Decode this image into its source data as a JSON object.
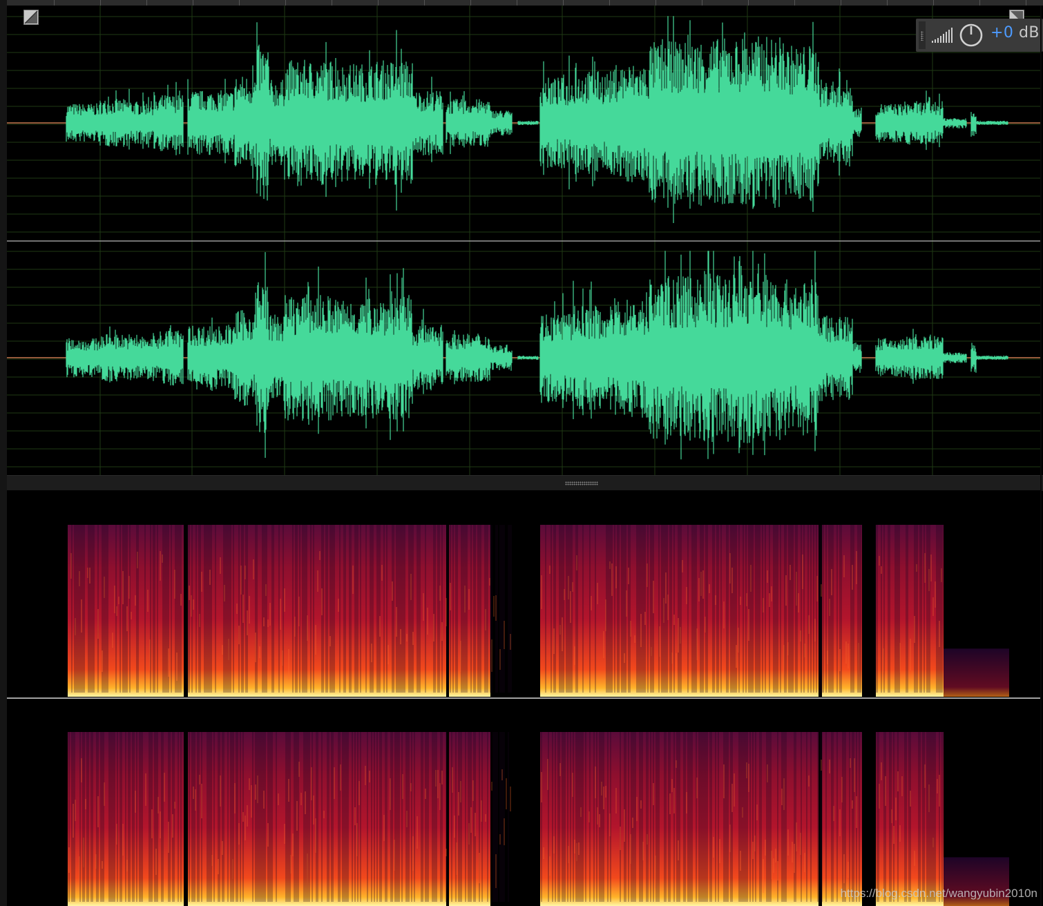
{
  "app": {
    "view": "waveform-and-spectral-frequency-display",
    "channels": [
      "left",
      "right"
    ]
  },
  "hud": {
    "gain_value": "+0",
    "gain_unit": "dB",
    "gain_color": "#4d9bff",
    "icons": [
      "level-meter-icon",
      "power-knob-icon"
    ]
  },
  "colors": {
    "waveform": "#45d99a",
    "grid": "#1f3a14",
    "center_line": "#c87850",
    "background": "#000000"
  },
  "watermark": "https://blog.csdn.net/wangyubin2010n"
}
